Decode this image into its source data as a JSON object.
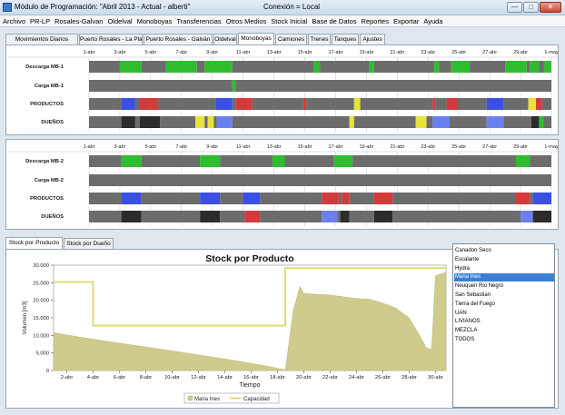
{
  "window": {
    "title": "Módulo de Programación: \"Abril 2013 - Actual - alberti\"",
    "connection": "Conexión = Local",
    "minimize_label": "—",
    "maximize_label": "□",
    "close_label": "✕"
  },
  "menu": [
    "Archivo",
    "PR-LP",
    "Rosales-Galvan",
    "Oldelval",
    "Monoboyas",
    "Transferencias",
    "Otros Medios",
    "Stock Inicial",
    "Base de Datos",
    "Reportes",
    "Exportar",
    "Ayuda"
  ],
  "tabs": [
    {
      "label": "Movimientos Diarios",
      "active": false
    },
    {
      "label": "Puerto Rosales - La Plata",
      "active": false
    },
    {
      "label": "Puerto Rosales - Galván",
      "active": false
    },
    {
      "label": "Oldelval",
      "active": false
    },
    {
      "label": "Monoboyas",
      "active": true
    },
    {
      "label": "Camiones",
      "active": false
    },
    {
      "label": "Trenes",
      "active": false
    },
    {
      "label": "Tanques",
      "active": false
    },
    {
      "label": "Ajustes",
      "active": false
    }
  ],
  "timeline_dates": [
    "1-abr",
    "3-abr",
    "5-abr",
    "7-abr",
    "9-abr",
    "11-abr",
    "13-abr",
    "15-abr",
    "17-abr",
    "19-abr",
    "21-abr",
    "23-abr",
    "25-abr",
    "27-abr",
    "29-abr",
    "1-may"
  ],
  "colors": {
    "gray": "#6c6c6c",
    "green": "#2fbd2f",
    "blue": "#3b4fe6",
    "red": "#d43a3a",
    "yellow": "#e6e33a",
    "black": "#2c2c2c",
    "ltblue": "#6b80ef",
    "capacity_line": "#dcdc78",
    "area_fill": "#cfcb8c",
    "selected": "#3c7fd8"
  },
  "gantt_panels": [
    {
      "rows": [
        {
          "label": "Descarga MB-1",
          "segments": [
            {
              "s": 0,
              "e": 1,
              "c": "gray"
            },
            {
              "s": 1,
              "e": 1.7,
              "c": "green"
            },
            {
              "s": 1.7,
              "e": 2.5,
              "c": "gray"
            },
            {
              "s": 2.5,
              "e": 3.5,
              "c": "green"
            },
            {
              "s": 3.5,
              "e": 3.75,
              "c": "gray"
            },
            {
              "s": 3.75,
              "e": 4.65,
              "c": "green"
            },
            {
              "s": 4.65,
              "e": 7.3,
              "c": "gray"
            },
            {
              "s": 7.3,
              "e": 7.5,
              "c": "green"
            },
            {
              "s": 7.5,
              "e": 9.1,
              "c": "gray"
            },
            {
              "s": 9.1,
              "e": 9.25,
              "c": "green"
            },
            {
              "s": 9.25,
              "e": 11.2,
              "c": "gray"
            },
            {
              "s": 11.2,
              "e": 11.35,
              "c": "green"
            },
            {
              "s": 11.35,
              "e": 11.75,
              "c": "gray"
            },
            {
              "s": 11.75,
              "e": 12.35,
              "c": "green"
            },
            {
              "s": 12.35,
              "e": 13.5,
              "c": "gray"
            },
            {
              "s": 13.5,
              "e": 14.2,
              "c": "green"
            },
            {
              "s": 14.2,
              "e": 14.3,
              "c": "gray"
            },
            {
              "s": 14.3,
              "e": 14.6,
              "c": "green"
            },
            {
              "s": 14.6,
              "e": 14.75,
              "c": "gray"
            },
            {
              "s": 14.75,
              "e": 15.0,
              "c": "green"
            }
          ]
        },
        {
          "label": "Carga MB-1",
          "segments": [
            {
              "s": 0,
              "e": 4.65,
              "c": "gray"
            },
            {
              "s": 4.65,
              "e": 4.75,
              "c": "green"
            },
            {
              "s": 4.75,
              "e": 15.0,
              "c": "gray"
            }
          ]
        },
        {
          "label": "PRODUCTOS",
          "segments": [
            {
              "s": 0,
              "e": 1.05,
              "c": "gray"
            },
            {
              "s": 1.05,
              "e": 1.5,
              "c": "blue"
            },
            {
              "s": 1.5,
              "e": 1.65,
              "c": "gray"
            },
            {
              "s": 1.65,
              "e": 2.25,
              "c": "red"
            },
            {
              "s": 2.25,
              "e": 4.1,
              "c": "gray"
            },
            {
              "s": 4.1,
              "e": 4.65,
              "c": "blue"
            },
            {
              "s": 4.65,
              "e": 4.75,
              "c": "gray"
            },
            {
              "s": 4.75,
              "e": 5.3,
              "c": "red"
            },
            {
              "s": 5.3,
              "e": 6.95,
              "c": "gray"
            },
            {
              "s": 6.95,
              "e": 7.05,
              "c": "red"
            },
            {
              "s": 7.05,
              "e": 8.6,
              "c": "gray"
            },
            {
              "s": 8.6,
              "e": 8.8,
              "c": "yellow"
            },
            {
              "s": 8.8,
              "e": 11.15,
              "c": "gray"
            },
            {
              "s": 11.15,
              "e": 11.25,
              "c": "red"
            },
            {
              "s": 11.25,
              "e": 11.6,
              "c": "gray"
            },
            {
              "s": 11.6,
              "e": 11.95,
              "c": "red"
            },
            {
              "s": 11.95,
              "e": 12.9,
              "c": "gray"
            },
            {
              "s": 12.9,
              "e": 13.45,
              "c": "blue"
            },
            {
              "s": 13.45,
              "e": 14.25,
              "c": "gray"
            },
            {
              "s": 14.25,
              "e": 14.5,
              "c": "yellow"
            },
            {
              "s": 14.5,
              "e": 14.7,
              "c": "red"
            },
            {
              "s": 14.7,
              "e": 15.0,
              "c": "gray"
            }
          ]
        },
        {
          "label": "DUEÑOS",
          "segments": [
            {
              "s": 0,
              "e": 1.05,
              "c": "gray"
            },
            {
              "s": 1.05,
              "e": 1.5,
              "c": "black"
            },
            {
              "s": 1.5,
              "e": 1.65,
              "c": "gray"
            },
            {
              "s": 1.65,
              "e": 2.3,
              "c": "black"
            },
            {
              "s": 2.3,
              "e": 3.45,
              "c": "gray"
            },
            {
              "s": 3.45,
              "e": 3.75,
              "c": "yellow"
            },
            {
              "s": 3.75,
              "e": 3.85,
              "c": "gray"
            },
            {
              "s": 3.85,
              "e": 4.05,
              "c": "yellow"
            },
            {
              "s": 4.05,
              "e": 4.15,
              "c": "gray"
            },
            {
              "s": 4.15,
              "e": 4.65,
              "c": "ltblue"
            },
            {
              "s": 4.65,
              "e": 8.45,
              "c": "gray"
            },
            {
              "s": 8.45,
              "e": 8.6,
              "c": "yellow"
            },
            {
              "s": 8.6,
              "e": 10.6,
              "c": "gray"
            },
            {
              "s": 10.6,
              "e": 10.95,
              "c": "yellow"
            },
            {
              "s": 10.95,
              "e": 11.15,
              "c": "gray"
            },
            {
              "s": 11.15,
              "e": 11.7,
              "c": "ltblue"
            },
            {
              "s": 11.7,
              "e": 12.9,
              "c": "gray"
            },
            {
              "s": 12.9,
              "e": 13.45,
              "c": "ltblue"
            },
            {
              "s": 13.45,
              "e": 14.35,
              "c": "gray"
            },
            {
              "s": 14.35,
              "e": 14.6,
              "c": "black"
            },
            {
              "s": 14.6,
              "e": 14.75,
              "c": "green"
            },
            {
              "s": 14.75,
              "e": 15.0,
              "c": "gray"
            }
          ]
        }
      ]
    },
    {
      "rows": [
        {
          "label": "Descarga MB-2",
          "segments": [
            {
              "s": 0,
              "e": 1.05,
              "c": "gray"
            },
            {
              "s": 1.05,
              "e": 1.7,
              "c": "green"
            },
            {
              "s": 1.7,
              "e": 3.6,
              "c": "gray"
            },
            {
              "s": 3.6,
              "e": 4.25,
              "c": "green"
            },
            {
              "s": 4.25,
              "e": 5.95,
              "c": "gray"
            },
            {
              "s": 5.95,
              "e": 6.35,
              "c": "green"
            },
            {
              "s": 6.35,
              "e": 7.95,
              "c": "gray"
            },
            {
              "s": 7.95,
              "e": 8.55,
              "c": "green"
            },
            {
              "s": 8.55,
              "e": 13.85,
              "c": "gray"
            },
            {
              "s": 13.85,
              "e": 14.3,
              "c": "green"
            },
            {
              "s": 14.3,
              "e": 15.0,
              "c": "gray"
            }
          ]
        },
        {
          "label": "Carga MB-2",
          "segments": [
            {
              "s": 0,
              "e": 15.0,
              "c": "gray"
            }
          ]
        },
        {
          "label": "PRODUCTOS",
          "segments": [
            {
              "s": 0,
              "e": 1.05,
              "c": "gray"
            },
            {
              "s": 1.05,
              "e": 1.7,
              "c": "blue"
            },
            {
              "s": 1.7,
              "e": 3.6,
              "c": "gray"
            },
            {
              "s": 3.6,
              "e": 4.25,
              "c": "blue"
            },
            {
              "s": 4.25,
              "e": 5.0,
              "c": "gray"
            },
            {
              "s": 5.0,
              "e": 5.55,
              "c": "blue"
            },
            {
              "s": 5.55,
              "e": 7.55,
              "c": "gray"
            },
            {
              "s": 7.55,
              "e": 8.1,
              "c": "red"
            },
            {
              "s": 8.1,
              "e": 8.2,
              "c": "gray"
            },
            {
              "s": 8.2,
              "e": 8.45,
              "c": "red"
            },
            {
              "s": 8.45,
              "e": 9.25,
              "c": "gray"
            },
            {
              "s": 9.25,
              "e": 9.85,
              "c": "red"
            },
            {
              "s": 9.85,
              "e": 13.85,
              "c": "gray"
            },
            {
              "s": 13.85,
              "e": 14.3,
              "c": "red"
            },
            {
              "s": 14.3,
              "e": 14.4,
              "c": "gray"
            },
            {
              "s": 14.4,
              "e": 15.0,
              "c": "blue"
            }
          ]
        },
        {
          "label": "DUEÑOS",
          "segments": [
            {
              "s": 0,
              "e": 1.05,
              "c": "gray"
            },
            {
              "s": 1.05,
              "e": 1.7,
              "c": "black"
            },
            {
              "s": 1.7,
              "e": 3.6,
              "c": "gray"
            },
            {
              "s": 3.6,
              "e": 4.25,
              "c": "black"
            },
            {
              "s": 4.25,
              "e": 5.05,
              "c": "gray"
            },
            {
              "s": 5.05,
              "e": 5.55,
              "c": "red"
            },
            {
              "s": 5.55,
              "e": 7.55,
              "c": "gray"
            },
            {
              "s": 7.55,
              "e": 8.05,
              "c": "ltblue"
            },
            {
              "s": 8.05,
              "e": 8.15,
              "c": "gray"
            },
            {
              "s": 8.15,
              "e": 8.45,
              "c": "black"
            },
            {
              "s": 8.45,
              "e": 9.25,
              "c": "gray"
            },
            {
              "s": 9.25,
              "e": 9.85,
              "c": "black"
            },
            {
              "s": 9.85,
              "e": 14.0,
              "c": "gray"
            },
            {
              "s": 14.0,
              "e": 14.4,
              "c": "ltblue"
            },
            {
              "s": 14.4,
              "e": 15.0,
              "c": "black"
            }
          ]
        }
      ]
    }
  ],
  "subtabs": [
    {
      "label": "Stock por Producto",
      "active": true
    },
    {
      "label": "Stock por Dueño",
      "active": false
    }
  ],
  "list_items": [
    {
      "label": "Canadon Seco",
      "selected": false
    },
    {
      "label": "Escalante",
      "selected": false
    },
    {
      "label": "Hydra",
      "selected": false
    },
    {
      "label": "Maria Ines",
      "selected": true
    },
    {
      "label": "Neuquen Rio Negro",
      "selected": false
    },
    {
      "label": "San Sebastian",
      "selected": false
    },
    {
      "label": "Tierra del Fuego",
      "selected": false
    },
    {
      "label": "UAN",
      "selected": false
    },
    {
      "label": "LIVIANOS",
      "selected": false
    },
    {
      "label": "MEZCLA",
      "selected": false
    },
    {
      "label": "TODOS",
      "selected": false
    }
  ],
  "chart_data": {
    "type": "area",
    "title": "Stock por Producto",
    "xlabel": "Tiempo",
    "ylabel": "Volumen [m3]",
    "x_ticks": [
      "2-abr",
      "4-abr",
      "6-abr",
      "8-abr",
      "10-abr",
      "12-abr",
      "14-abr",
      "16-abr",
      "18-abr",
      "20-abr",
      "22-abr",
      "24-abr",
      "26-abr",
      "28-abr",
      "30-abr"
    ],
    "y_ticks": [
      "0",
      "5.000",
      "10.000",
      "15.000",
      "20.000",
      "25.000",
      "30.000"
    ],
    "xlim": [
      1,
      30.8
    ],
    "ylim": [
      0,
      30000
    ],
    "series": [
      {
        "name": "Maria Ines",
        "kind": "area",
        "x": [
          1,
          3,
          6,
          10,
          14,
          17,
          18.6,
          19.2,
          19.7,
          20,
          21,
          22,
          23,
          24,
          25,
          26,
          27,
          28,
          28.8,
          29.3,
          29.7,
          30,
          30.8
        ],
        "y": [
          10800,
          9500,
          7800,
          5600,
          3300,
          1400,
          200,
          17000,
          24000,
          22000,
          21700,
          21500,
          21000,
          20500,
          20300,
          19200,
          17800,
          15000,
          10000,
          6500,
          6000,
          27000,
          28000
        ]
      },
      {
        "name": "Capacidad",
        "kind": "step",
        "x": [
          1,
          4,
          4,
          18.6,
          18.6,
          30.8
        ],
        "y": [
          25200,
          25200,
          12800,
          12800,
          29200,
          29200
        ]
      }
    ],
    "legend": [
      "Maria Ines",
      "Capacidad"
    ],
    "legend_position": "bottom",
    "grid": false
  }
}
